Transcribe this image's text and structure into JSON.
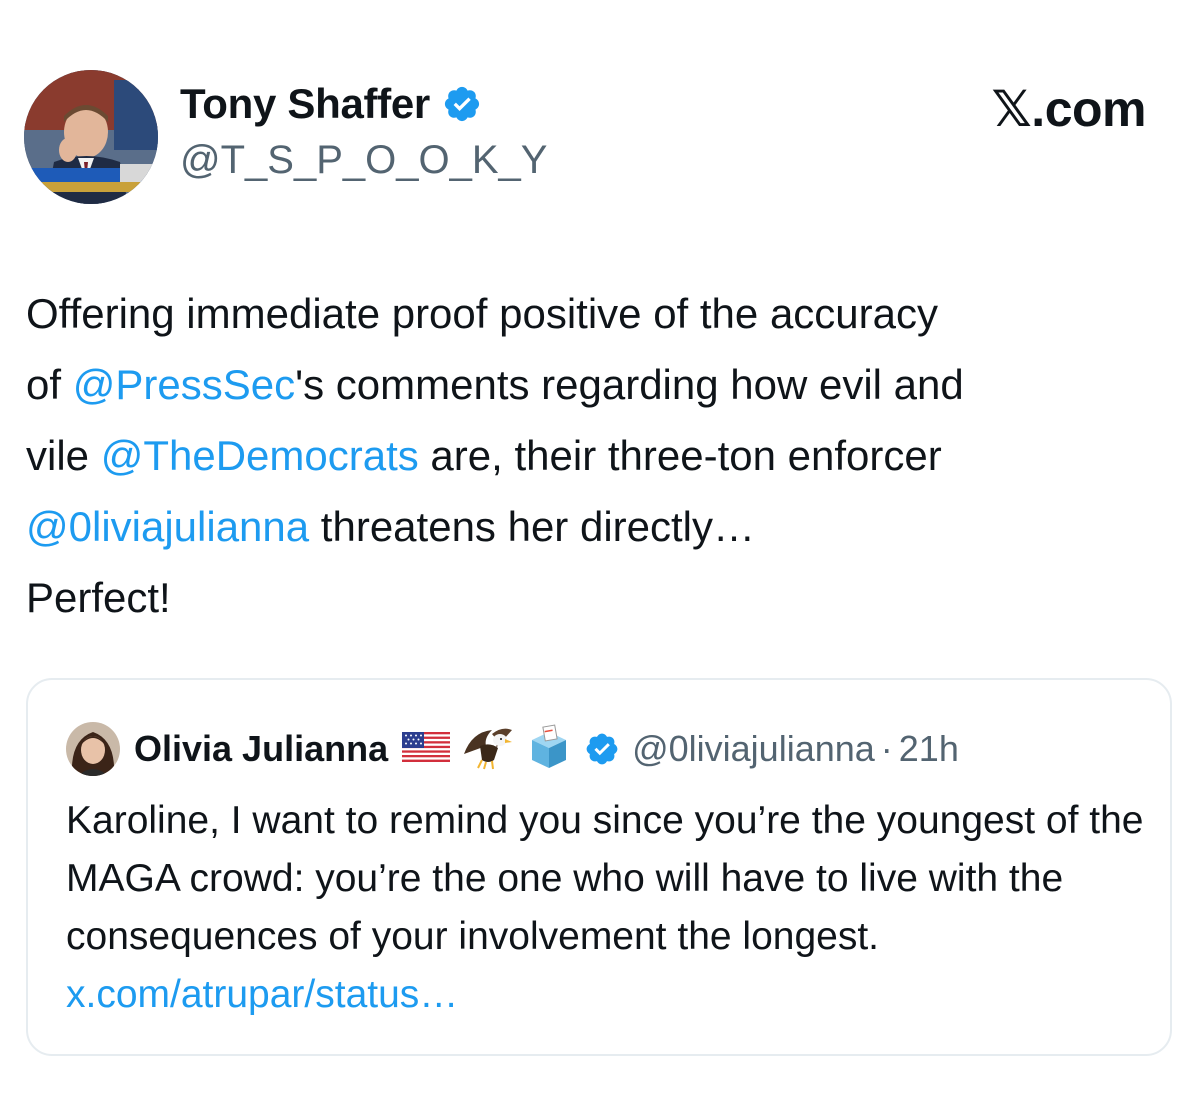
{
  "tweet": {
    "author": {
      "display_name": "Tony Shaffer",
      "handle": "@T_S_P_O_O_K_Y",
      "verified": true,
      "avatar_icon": "avatar-news-broadcast"
    },
    "brand": "𝕏.com",
    "body": {
      "line1": "Offering immediate proof positive of the accuracy",
      "line2_pre": "of ",
      "mention_presssec": "@PressSec",
      "line2_post": "'s comments regarding how evil and",
      "line3_pre": "vile ",
      "mention_democrats": "@TheDemocrats",
      "line3_post": " are, their three-ton enforcer",
      "mention_olivia": "@0liviajulianna",
      "line4_post": " threatens her directly…",
      "line5": "Perfect!"
    },
    "quoted": {
      "display_name": "Olivia Julianna",
      "emojis": [
        "us-flag-icon",
        "eagle-icon",
        "ballot-box-icon"
      ],
      "verified": true,
      "handle": "@0liviajulianna",
      "separator": "·",
      "time": "21h",
      "body_text": "Karoline, I want to remind you since you’re the youngest of the MAGA crowd: you’re the one who will have to live with the consequences of your involvement the longest.",
      "link": "x.com/atrupar/status…"
    }
  },
  "colors": {
    "text": "#0f1419",
    "muted": "#536471",
    "accent": "#1d9bf0",
    "border": "#e6ecf0"
  }
}
